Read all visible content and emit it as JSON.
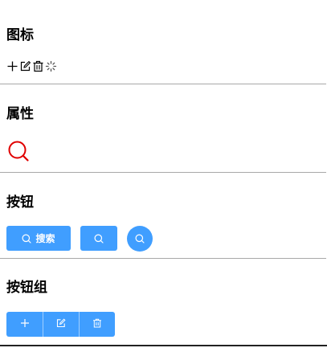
{
  "sections": {
    "icons": {
      "title": "图标",
      "icons": [
        "plus-icon",
        "edit-icon",
        "delete-icon",
        "loading-icon"
      ]
    },
    "attributes": {
      "title": "属性",
      "icon": "search-icon",
      "icon_color": "#e00000"
    },
    "buttons": {
      "title": "按钮",
      "search_label": "搜索",
      "icon": "search-icon"
    },
    "button_group": {
      "title": "按钮组",
      "icons": [
        "plus-icon",
        "edit-icon",
        "delete-icon"
      ]
    }
  },
  "colors": {
    "primary": "#409eff",
    "divider": "#a8a8a8",
    "accent_red": "#e00000"
  }
}
